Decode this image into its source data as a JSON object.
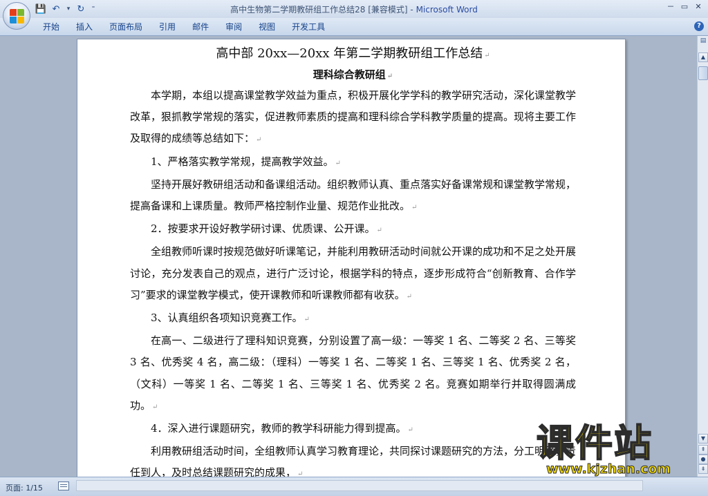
{
  "window": {
    "title": "高中生物第二学期教研组工作总结28 [兼容模式]",
    "title_sep": " - ",
    "app_name": "Microsoft Word",
    "controls": {
      "minimize": "－",
      "restore": "▭",
      "close": "✕"
    }
  },
  "quick_access": {
    "save": "💾",
    "undo": "↶",
    "dropdown": "▾",
    "redo": "↻",
    "customize": "⁼"
  },
  "ribbon": {
    "tabs": [
      "开始",
      "插入",
      "页面布局",
      "引用",
      "邮件",
      "审阅",
      "视图",
      "开发工具"
    ],
    "help": "?"
  },
  "document": {
    "title": "高中部 20xx—20xx 年第二学期教研组工作总结",
    "subtitle": "理科综合教研组",
    "paragraphs": [
      "本学期，本组以提高课堂教学效益为重点，积极开展化学学科的教学研究活动，深化课堂教学改革，狠抓教学常规的落实，促进教师素质的提高和理科综合学科教学质量的提高。现将主要工作及取得的成绩等总结如下：",
      "1、严格落实教学常规，提高教学效益。",
      "坚持开展好教研组活动和备课组活动。组织教师认真、重点落实好备课常规和课堂教学常规，提高备课和上课质量。教师严格控制作业量、规范作业批改。",
      "2．按要求开设好教学研讨课、优质课、公开课。",
      "全组教师听课时按规范做好听课笔记，并能利用教研活动时间就公开课的成功和不足之处开展讨论，充分发表自己的观点，进行广泛讨论，根据学科的特点，逐步形成符合“创新教育、合作学习”要求的课堂教学模式，使开课教师和听课教师都有收获。",
      "3、认真组织各项知识竞赛工作。",
      "在高一、二级进行了理科知识竞赛，分别设置了高一级：一等奖 1 名、二等奖 2 名、三等奖 3 名、优秀奖 4 名，高二级：（理科）一等奖 1 名、二等奖 1 名、三等奖 1 名、优秀奖 2 名，（文科）一等奖 1 名、二等奖 1 名、三等奖 1 名、优秀奖 2 名。竞赛如期举行并取得圆满成功。",
      "4．深入进行课题研究，教师的教学科研能力得到提高。",
      "利用教研组活动时间，全组教师认真学习教育理论，共同探讨课题研究的方法，分工明确，责任到人，及时总结课题研究的成果，"
    ],
    "paragraph_mark": "↵"
  },
  "statusbar": {
    "page_label": "页面: 1/15"
  },
  "watermark": {
    "main": "课件站",
    "url": "www.kjzhan.com"
  }
}
